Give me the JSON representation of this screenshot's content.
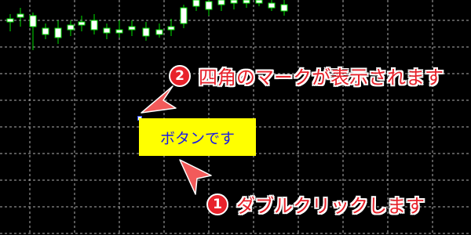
{
  "colors": {
    "background": "#000000",
    "grid": "#b0b0b0",
    "bull_wick": "#00e000",
    "body_fill": "#ffffff",
    "button_bg": "#ffff00",
    "button_text": "#1a1ae6",
    "callout_red": "#e8222b",
    "callout_outline": "#ffffff",
    "arrow_fill": "#f25a5a"
  },
  "chart_button": {
    "label": "ボタンです"
  },
  "callouts": [
    {
      "number": "2",
      "text": "四角のマークが表示されます"
    },
    {
      "number": "1",
      "text": "ダブルクリックします"
    }
  ],
  "icons": {
    "anchor": "selection-square-icon",
    "arrow": "pointer-arrow-icon"
  }
}
